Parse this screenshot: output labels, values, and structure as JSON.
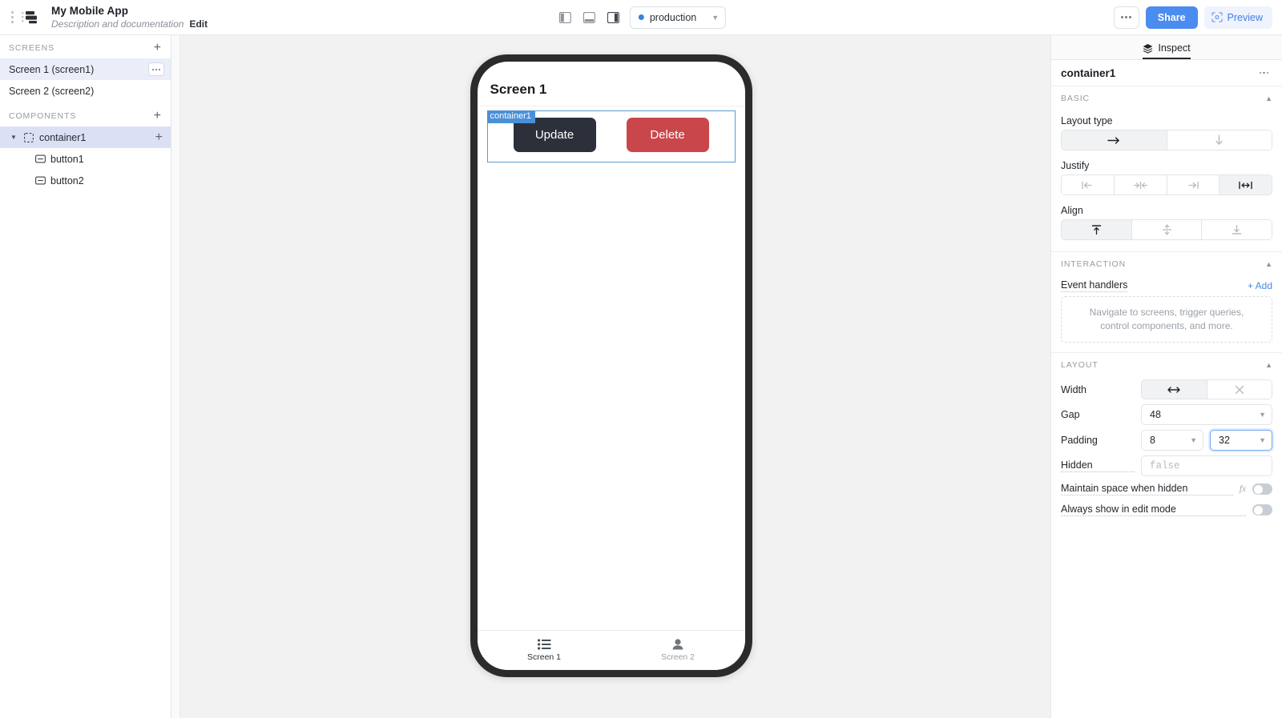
{
  "topbar": {
    "app_title": "My Mobile App",
    "app_subtitle": "Description and documentation",
    "edit_label": "Edit",
    "panel_toggles": [
      {
        "name": "left-panel-toggle-icon"
      },
      {
        "name": "bottom-panel-toggle-icon"
      },
      {
        "name": "right-panel-toggle-icon"
      }
    ],
    "environment": {
      "value": "production",
      "dot_color": "#3b7fe0",
      "caret": "⌄"
    },
    "more_label": "···",
    "share_label": "Share",
    "preview_label": "Preview",
    "share_color": "#4a8cf0",
    "preview_color": "#3f7fe8"
  },
  "sidebar": {
    "screens": {
      "title": "SCREENS",
      "add_label": "+",
      "items": [
        {
          "label": "Screen 1 (screen1)",
          "selected": true,
          "has_menu": true
        },
        {
          "label": "Screen 2 (screen2)",
          "selected": false,
          "has_menu": false
        }
      ]
    },
    "components": {
      "title": "COMPONENTS",
      "add_label": "+",
      "items": [
        {
          "label": "container1",
          "selected": true,
          "expanded": true,
          "icon": "container-icon",
          "add_label": "+"
        },
        {
          "label": "button1",
          "selected": false,
          "icon": "button-icon"
        },
        {
          "label": "button2",
          "selected": false,
          "icon": "button-icon"
        }
      ]
    }
  },
  "canvas": {
    "screen_title": "Screen 1",
    "selection_label": "container1",
    "selection_color": "#4a90d9",
    "buttons": [
      {
        "label": "Update",
        "color": "#2b303b",
        "name": "button1"
      },
      {
        "label": "Delete",
        "color": "#c9474a",
        "name": "button2"
      }
    ],
    "tabbar": [
      {
        "label": "Screen 1",
        "icon": "list-icon",
        "active": true
      },
      {
        "label": "Screen 2",
        "icon": "person-icon",
        "active": false
      }
    ]
  },
  "inspector": {
    "tab_label": "Inspect",
    "component_name": "container1",
    "more_label": "···",
    "sections": {
      "basic": {
        "title": "BASIC",
        "layout_type": {
          "label": "Layout type",
          "options": [
            {
              "name": "layout-horizontal",
              "icon": "arrow-right-icon",
              "selected": true
            },
            {
              "name": "layout-vertical",
              "icon": "arrow-down-icon",
              "selected": false
            }
          ]
        },
        "justify": {
          "label": "Justify",
          "options": [
            {
              "name": "justify-start",
              "icon": "align-start-icon",
              "selected": false
            },
            {
              "name": "justify-center",
              "icon": "align-center-icon",
              "selected": false
            },
            {
              "name": "justify-end",
              "icon": "align-end-icon",
              "selected": false
            },
            {
              "name": "justify-space-between",
              "icon": "space-between-icon",
              "selected": true
            }
          ]
        },
        "align": {
          "label": "Align",
          "options": [
            {
              "name": "align-top",
              "icon": "align-top-icon",
              "selected": true
            },
            {
              "name": "align-middle",
              "icon": "align-middle-icon",
              "selected": false
            },
            {
              "name": "align-bottom",
              "icon": "align-bottom-icon",
              "selected": false
            }
          ]
        }
      },
      "interaction": {
        "title": "INTERACTION",
        "event_handlers_label": "Event handlers",
        "add_label": "+ Add",
        "empty_text": "Navigate to screens, trigger queries, control components, and more."
      },
      "layout": {
        "title": "LAYOUT",
        "width": {
          "label": "Width",
          "options": [
            {
              "name": "width-fill",
              "icon": "arrows-horizontal-icon",
              "selected": true
            },
            {
              "name": "width-none",
              "icon": "close-icon",
              "selected": false
            }
          ]
        },
        "gap": {
          "label": "Gap",
          "value": "48"
        },
        "padding": {
          "label": "Padding",
          "value_vertical": "8",
          "value_horizontal": "32",
          "focused_field": "horizontal"
        },
        "hidden": {
          "label": "Hidden",
          "placeholder": "false",
          "value": ""
        },
        "maintain_space": {
          "label": "Maintain space when hidden",
          "fx_label": "fx",
          "on": false
        },
        "always_show": {
          "label": "Always show in edit mode",
          "on": false
        }
      }
    }
  }
}
